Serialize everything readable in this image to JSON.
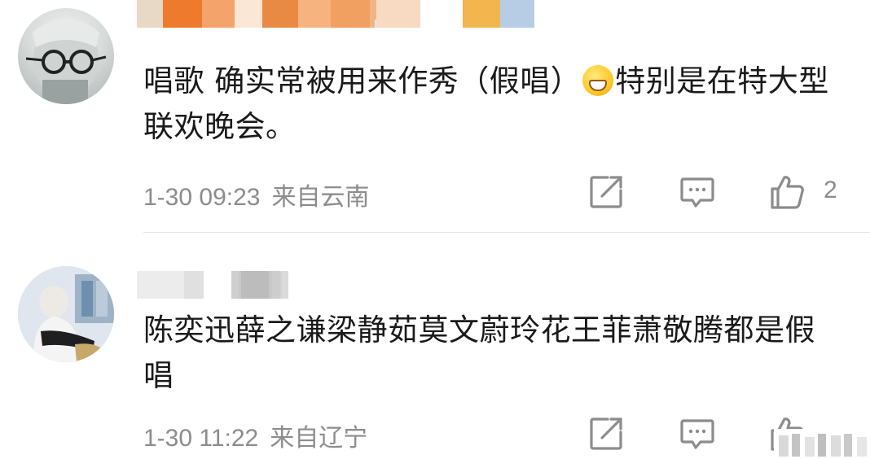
{
  "comments": [
    {
      "text_before_emoji": "唱歌 确实常被用来作秀（假唱）",
      "emoji": "grinning-face",
      "text_after_emoji": "特别是在特大型联欢晚会。",
      "date": "1-30 09:23",
      "location": "来自云南",
      "like_count": "2"
    },
    {
      "text": "陈奕迅薛之谦梁静茹莫文蔚玲花王菲萧敬腾都是假唱",
      "date": "1-30 11:22",
      "location": "来自辽宁"
    }
  ],
  "icons": {
    "share": "share-edit-icon",
    "comment": "comment-bubble-icon",
    "like": "thumbs-up-icon"
  },
  "colors": {
    "text": "#1a1a1a",
    "meta": "#8c8c8c",
    "icon": "#8c8c8c",
    "divider": "#e6e6e6"
  }
}
